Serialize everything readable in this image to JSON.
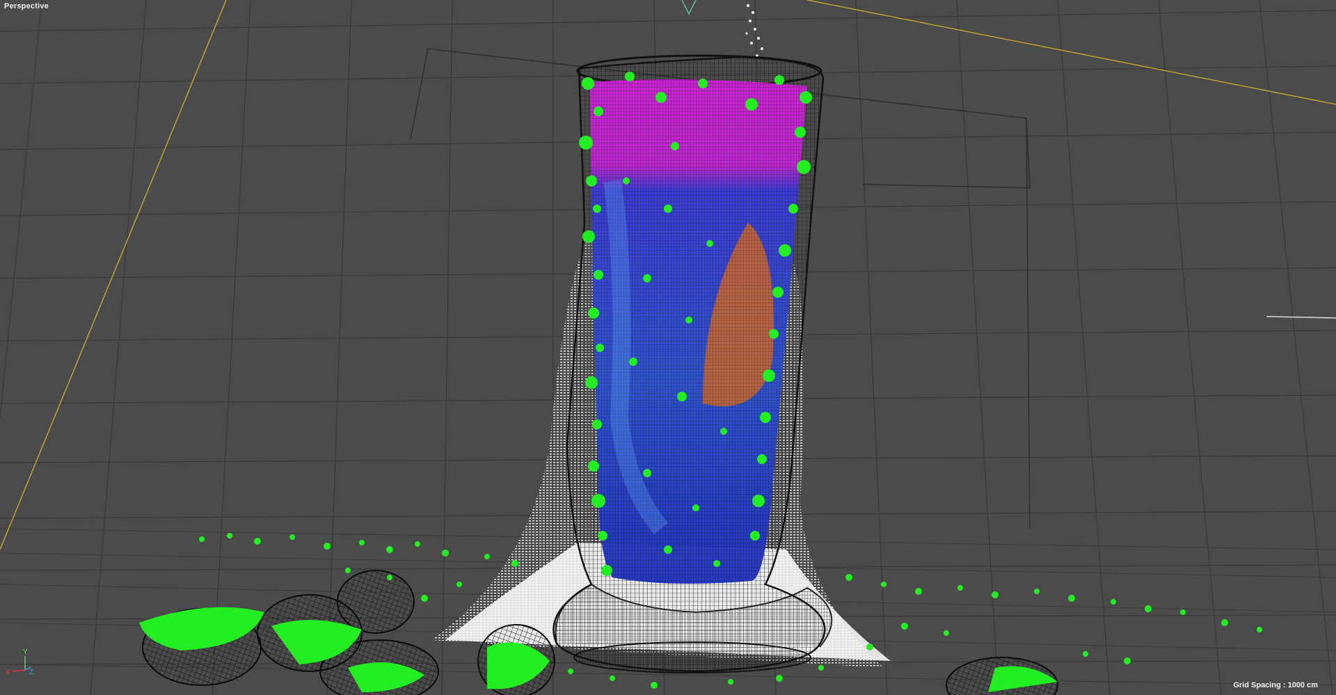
{
  "viewport": {
    "label": "Perspective",
    "grid_spacing": "Grid Spacing : 1000 cm"
  },
  "axis_gizmo": {
    "x_label": "X",
    "y_label": "Y",
    "z_label": "Z",
    "x_color": "#e03c3c",
    "y_color": "#6fd06f",
    "z_color": "#4a8cf0"
  },
  "colors": {
    "background": "#4b4b4b",
    "grid_line": "#383838",
    "particle_green": "#22ee22",
    "particle_magenta": "#e020e8",
    "particle_blue": "#2446d8",
    "particle_orange": "#e86a10",
    "foam_white": "#ffffff",
    "camera_line": "#c8a830",
    "wireframe": "#1a1a1a"
  },
  "objects": [
    "glass-wireframe",
    "liquid-particles",
    "foam-particles",
    "rock-wireframes",
    "camera-frustum"
  ]
}
